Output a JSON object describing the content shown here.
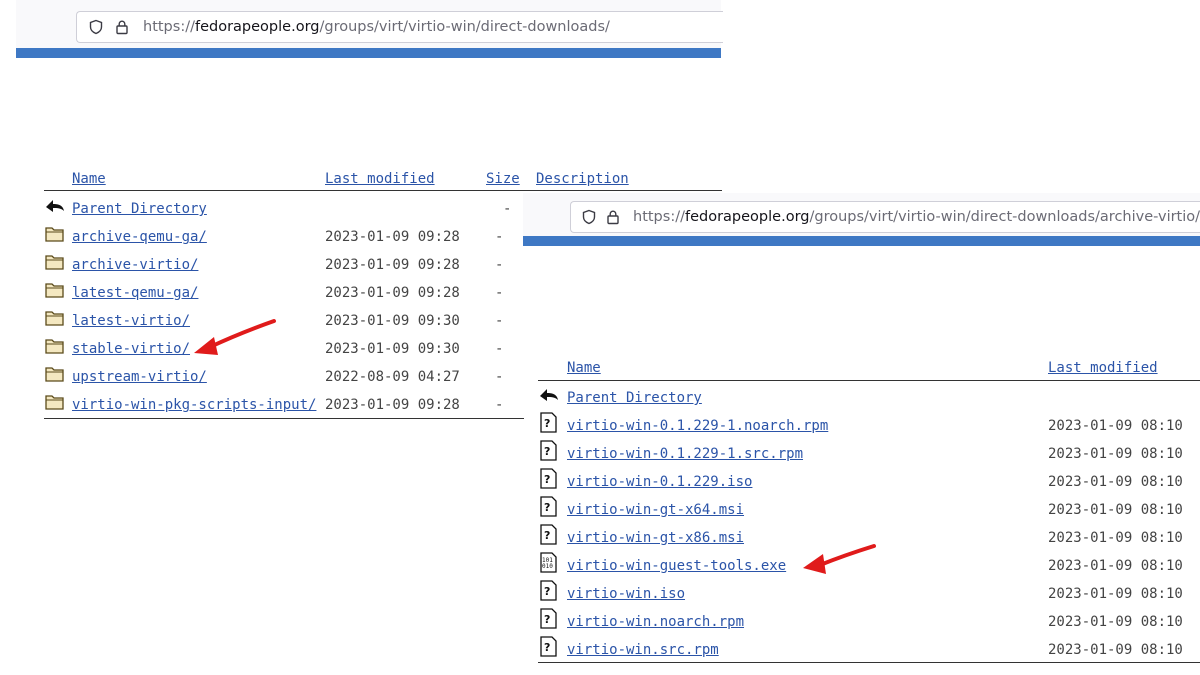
{
  "window1": {
    "address_bar": {
      "url_prefix": "https://",
      "host": "fedorapeople.org",
      "path": "/groups/virt/virtio-win/direct-downloads/"
    },
    "listing": {
      "headers": {
        "name": "Name",
        "last_modified": "Last modified",
        "size": "Size",
        "description": "Description"
      },
      "parent": {
        "name": "Parent Directory",
        "size": "-"
      },
      "rows": [
        {
          "name": "archive-qemu-ga/",
          "date": "2023-01-09 09:28",
          "size": "-"
        },
        {
          "name": "archive-virtio/",
          "date": "2023-01-09 09:28",
          "size": "-"
        },
        {
          "name": "latest-qemu-ga/",
          "date": "2023-01-09 09:28",
          "size": "-"
        },
        {
          "name": "latest-virtio/",
          "date": "2023-01-09 09:30",
          "size": "-"
        },
        {
          "name": "stable-virtio/",
          "date": "2023-01-09 09:30",
          "size": "-"
        },
        {
          "name": "upstream-virtio/",
          "date": "2022-08-09 04:27",
          "size": "-"
        },
        {
          "name": "virtio-win-pkg-scripts-input/",
          "date": "2023-01-09 09:28",
          "size": "-"
        }
      ]
    }
  },
  "window2": {
    "address_bar": {
      "url_prefix": "https://",
      "host": "fedorapeople.org",
      "path": "/groups/virt/virtio-win/direct-downloads/archive-virtio/virtio-win"
    },
    "listing": {
      "headers": {
        "name": "Name",
        "last_modified": "Last modified"
      },
      "parent": {
        "name": "Parent Directory"
      },
      "rows": [
        {
          "name": "virtio-win-0.1.229-1.noarch.rpm",
          "date": "2023-01-09 08:10"
        },
        {
          "name": "virtio-win-0.1.229-1.src.rpm",
          "date": "2023-01-09 08:10"
        },
        {
          "name": "virtio-win-0.1.229.iso",
          "date": "2023-01-09 08:10"
        },
        {
          "name": "virtio-win-gt-x64.msi",
          "date": "2023-01-09 08:10"
        },
        {
          "name": "virtio-win-gt-x86.msi",
          "date": "2023-01-09 08:10"
        },
        {
          "name": "virtio-win-guest-tools.exe",
          "date": "2023-01-09 08:10"
        },
        {
          "name": "virtio-win.iso",
          "date": "2023-01-09 08:10"
        },
        {
          "name": "virtio-win.noarch.rpm",
          "date": "2023-01-09 08:10"
        },
        {
          "name": "virtio-win.src.rpm",
          "date": "2023-01-09 08:10"
        }
      ]
    }
  },
  "colors": {
    "link": "#2b54a8",
    "accent_bar": "#3e78c4",
    "arrow": "#e01b1b"
  }
}
